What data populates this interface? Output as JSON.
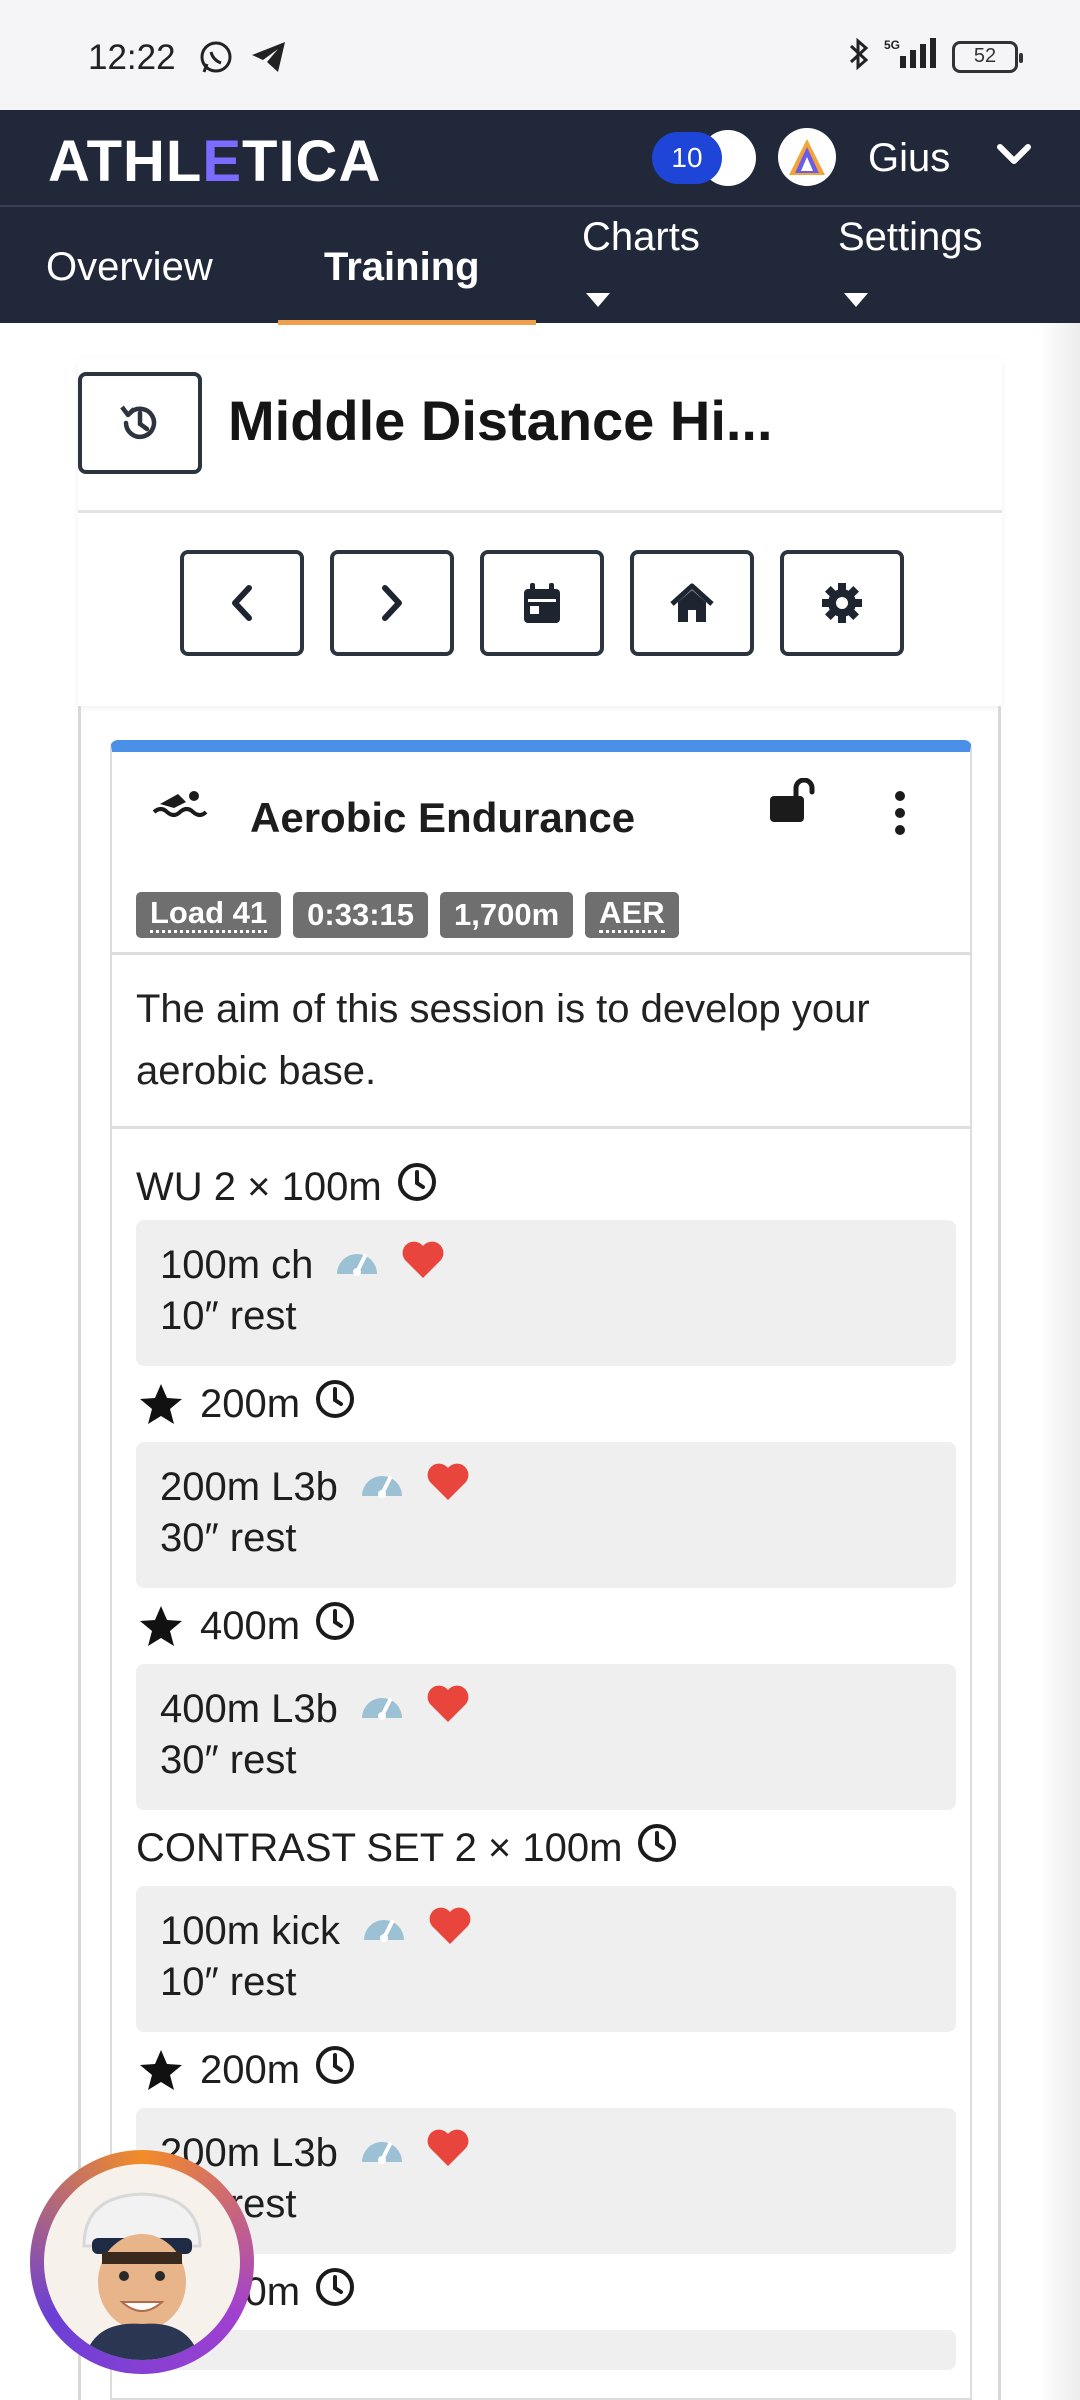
{
  "status_bar": {
    "time": "12:22",
    "battery": "52",
    "network": "5G"
  },
  "header": {
    "logo_pre": "ATHL",
    "logo_e": "E",
    "logo_post": "TICA",
    "notifications": "10",
    "username": "Gius"
  },
  "nav": {
    "items": [
      {
        "label": "Overview"
      },
      {
        "label": "Training"
      },
      {
        "label": "Charts"
      },
      {
        "label": "Settings"
      }
    ]
  },
  "page": {
    "title": "Middle Distance Hi..."
  },
  "workout": {
    "title": "Aerobic Endurance",
    "badges": {
      "load": "Load 41",
      "duration": "0:33:15",
      "distance": "1,700m",
      "type": "AER"
    },
    "description": "The aim of this session is to develop your aerobic base.",
    "blocks": [
      {
        "header": "WU 2 × 100m",
        "interval": "100m ch",
        "rest": "10″ rest"
      },
      {
        "header": "200m",
        "interval": "200m L3b",
        "rest": "30″ rest"
      },
      {
        "header": "400m",
        "interval": "400m L3b",
        "rest": "30″ rest"
      },
      {
        "header": "CONTRAST SET 2 × 100m",
        "interval": "100m kick",
        "rest": "10″ rest"
      },
      {
        "header": "200m",
        "interval": "200m L3b",
        "rest": "30″ rest"
      },
      {
        "header": "400m"
      }
    ]
  },
  "colors": {
    "header_bg": "#21283a",
    "accent_tab": "#f0a04b",
    "card_top": "#4a8fe7",
    "badge_bg": "#6f6f6f",
    "heart": "#e8453c",
    "gauge": "#9cc0d4"
  }
}
